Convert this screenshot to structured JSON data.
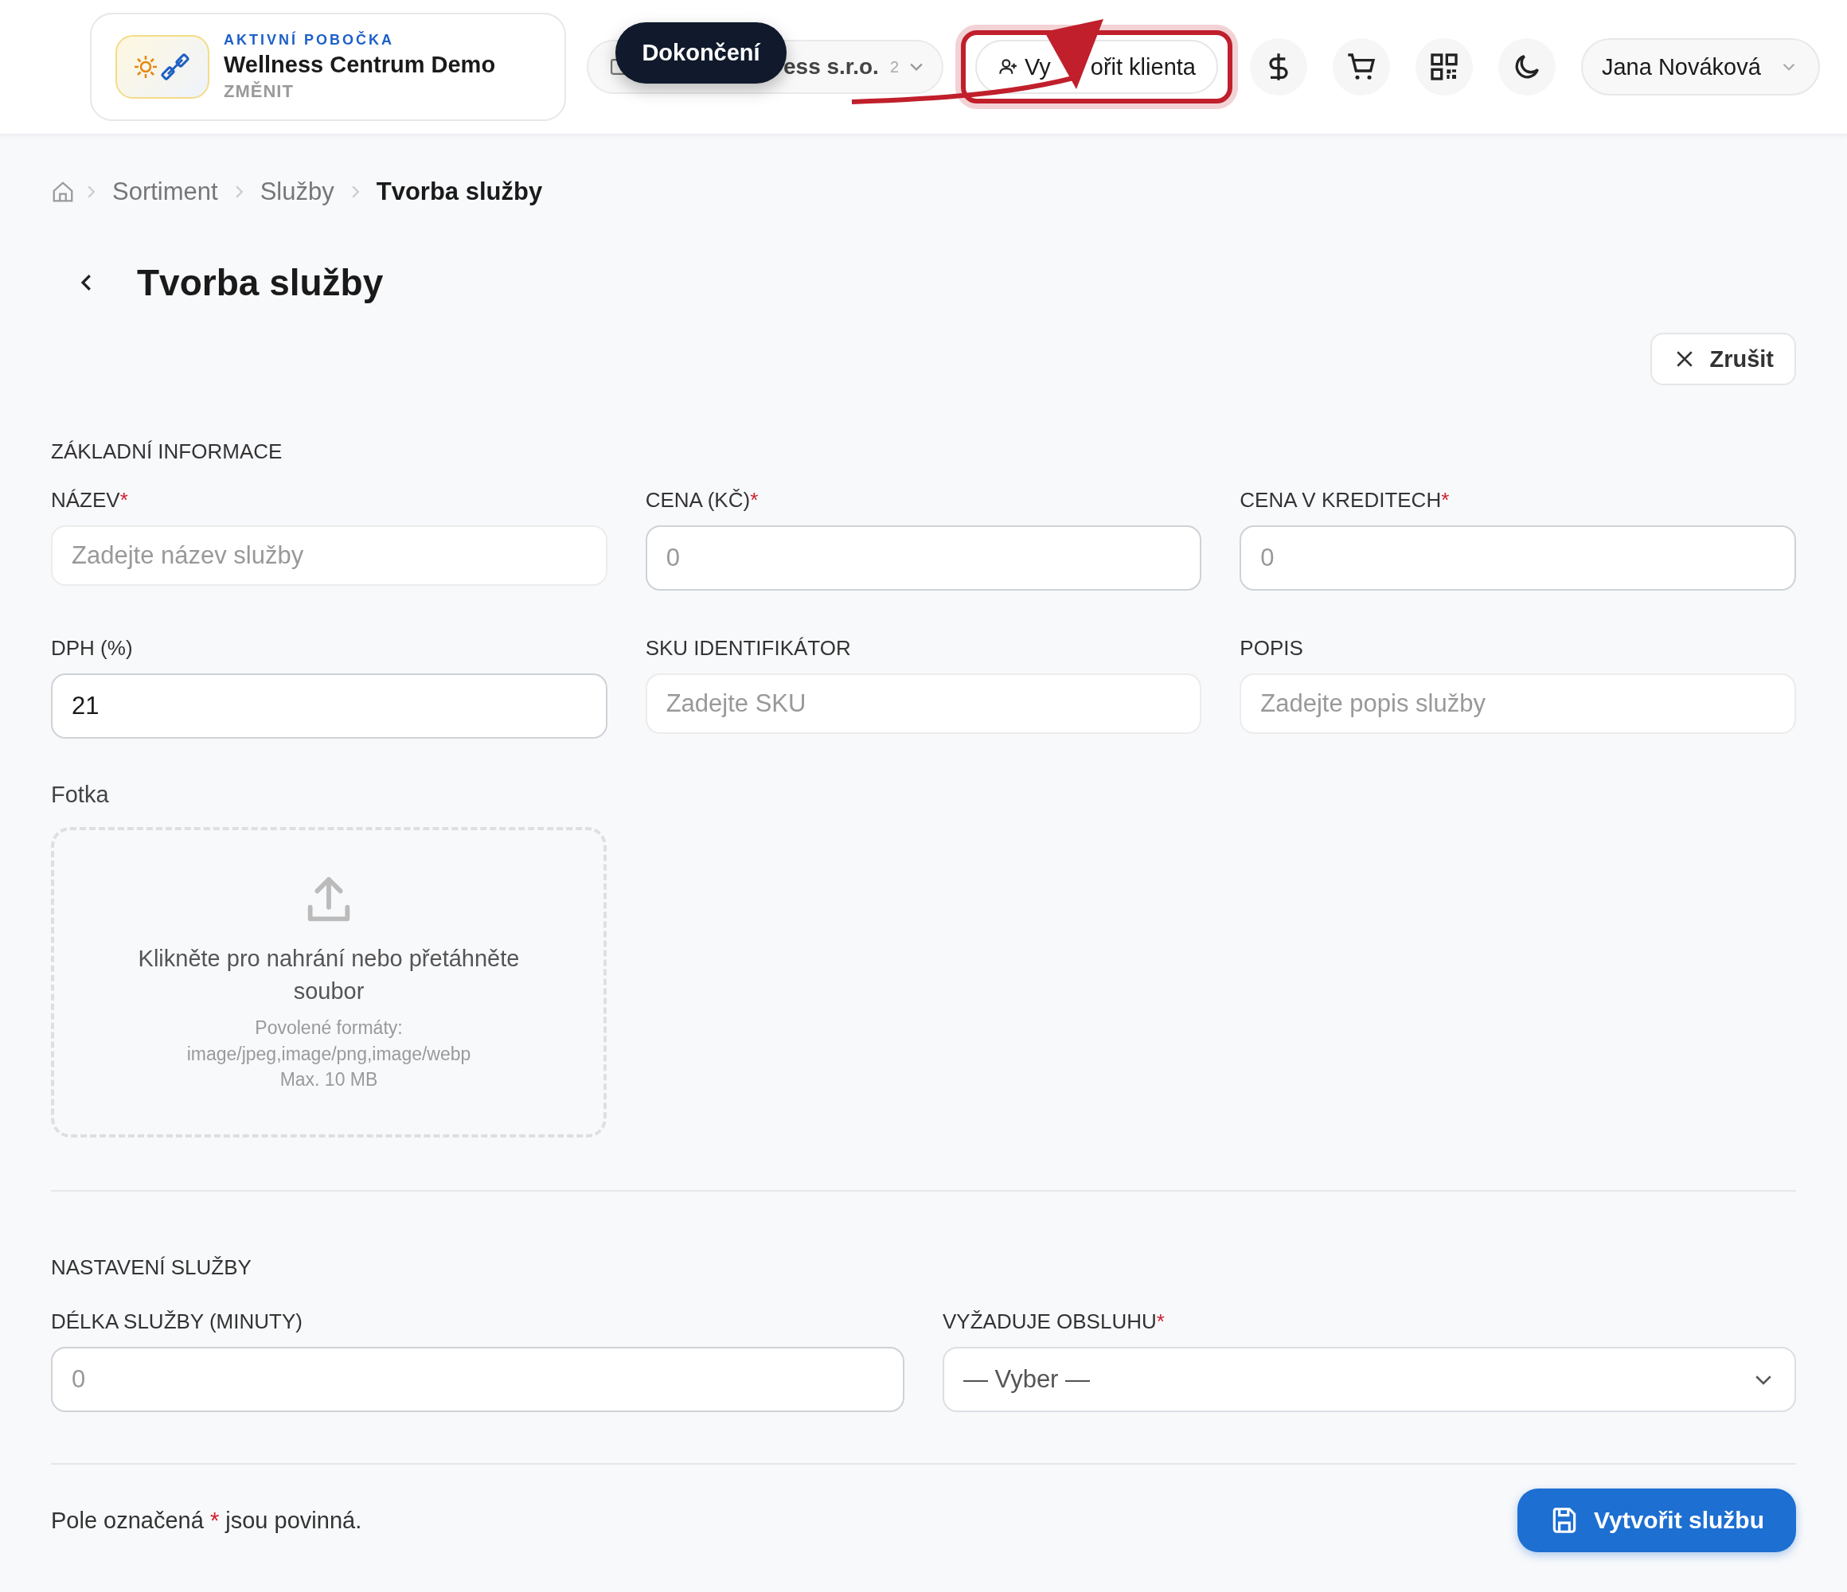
{
  "header": {
    "branch": {
      "caption": "AKTIVNÍ POBOČKA",
      "name": "Wellness Centrum Demo",
      "action": "ZMĚNIT"
    },
    "company": {
      "name": "ess s.r.o.",
      "count": "2"
    },
    "tooltip": "Dokončení",
    "create_client": {
      "label_start": "Vy",
      "label_end": "ořit klienta",
      "highlighted": true
    },
    "icon_buttons": [
      {
        "kind": "dollar"
      },
      {
        "kind": "cart"
      },
      {
        "kind": "qr"
      },
      {
        "kind": "moon"
      }
    ],
    "user": "Jana Nováková"
  },
  "breadcrumb": [
    {
      "label": "Sortiment",
      "current": false
    },
    {
      "label": "Služby",
      "current": false
    },
    {
      "label": "Tvorba služby",
      "current": true
    }
  ],
  "page_title": "Tvorba služby",
  "cancel_button": "Zrušit",
  "required_mark": "*",
  "basic_info": {
    "title": "ZÁKLADNÍ INFORMACE",
    "fields": [
      {
        "label": "NÁZEV",
        "required": true,
        "kind": "text",
        "placeholder": "Zadejte název služby"
      },
      {
        "label": "CENA (KČ)",
        "required": true,
        "kind": "number",
        "placeholder": "0"
      },
      {
        "label": "CENA V KREDITECH",
        "required": true,
        "kind": "number",
        "placeholder": "0"
      },
      {
        "label": "DPH (%)",
        "required": false,
        "kind": "number",
        "value": "21"
      },
      {
        "label": "SKU IDENTIFIKÁTOR",
        "required": false,
        "kind": "text",
        "placeholder": "Zadejte SKU"
      },
      {
        "label": "POPIS",
        "required": false,
        "kind": "text",
        "placeholder": "Zadejte popis služby"
      }
    ]
  },
  "photo": {
    "label": "Fotka",
    "prompt": "Klikněte pro nahrání nebo přetáhněte soubor",
    "formats_label": "Povolené formáty:",
    "formats": "image/jpeg,image/png,image/webp",
    "max_size": "Max. 10 MB"
  },
  "settings": {
    "title": "NASTAVENÍ SLUŽBY",
    "fields": [
      {
        "label": "DÉLKA SLUŽBY (MINUTY)",
        "required": false,
        "kind": "number",
        "placeholder": "0"
      },
      {
        "label": "VYŽADUJE OBSLUHU",
        "required": true,
        "kind": "select",
        "value": "— Vyber —"
      }
    ]
  },
  "footer": {
    "note_before": "Pole označená",
    "note_after": "jsou povinná.",
    "submit": "Vytvořit službu"
  }
}
